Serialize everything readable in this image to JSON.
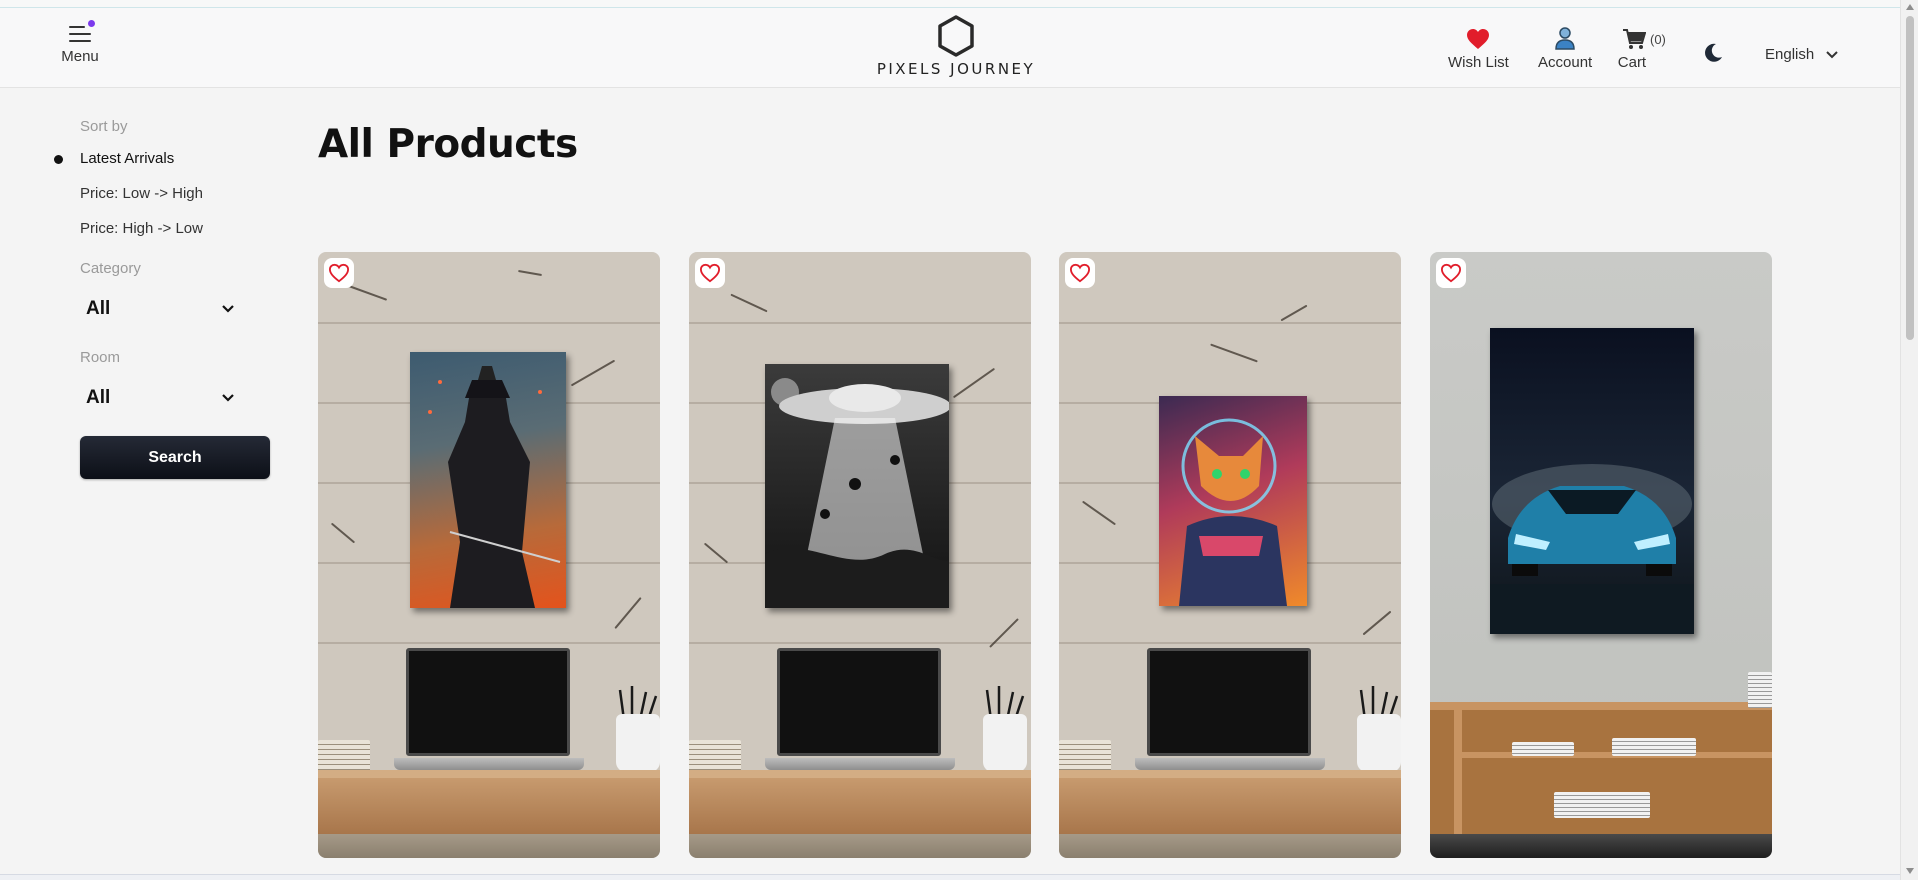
{
  "header": {
    "menu_label": "Menu",
    "logo_text": "PIXELS JOURNEY",
    "wishlist_label": "Wish List",
    "account_label": "Account",
    "cart_label": "Cart",
    "cart_count": "(0)",
    "language": "English",
    "colors": {
      "heart": "#e11d2b",
      "account": "#3b82c4",
      "menu_dot": "#7c3aed"
    }
  },
  "sidebar": {
    "sort_title": "Sort by",
    "sort_options": [
      {
        "label": "Latest Arrivals",
        "selected": true
      },
      {
        "label": "Price: Low -> High",
        "selected": false
      },
      {
        "label": "Price: High -> Low",
        "selected": false
      }
    ],
    "category_title": "Category",
    "category_value": "All",
    "room_title": "Room",
    "room_value": "All",
    "search_label": "Search"
  },
  "main": {
    "title": "All Products",
    "products": [
      {
        "image": "samurai-wall-art"
      },
      {
        "image": "ufo-cats-wall-art"
      },
      {
        "image": "astronaut-cat-wall-art"
      },
      {
        "image": "sports-car-wall-art"
      }
    ]
  }
}
